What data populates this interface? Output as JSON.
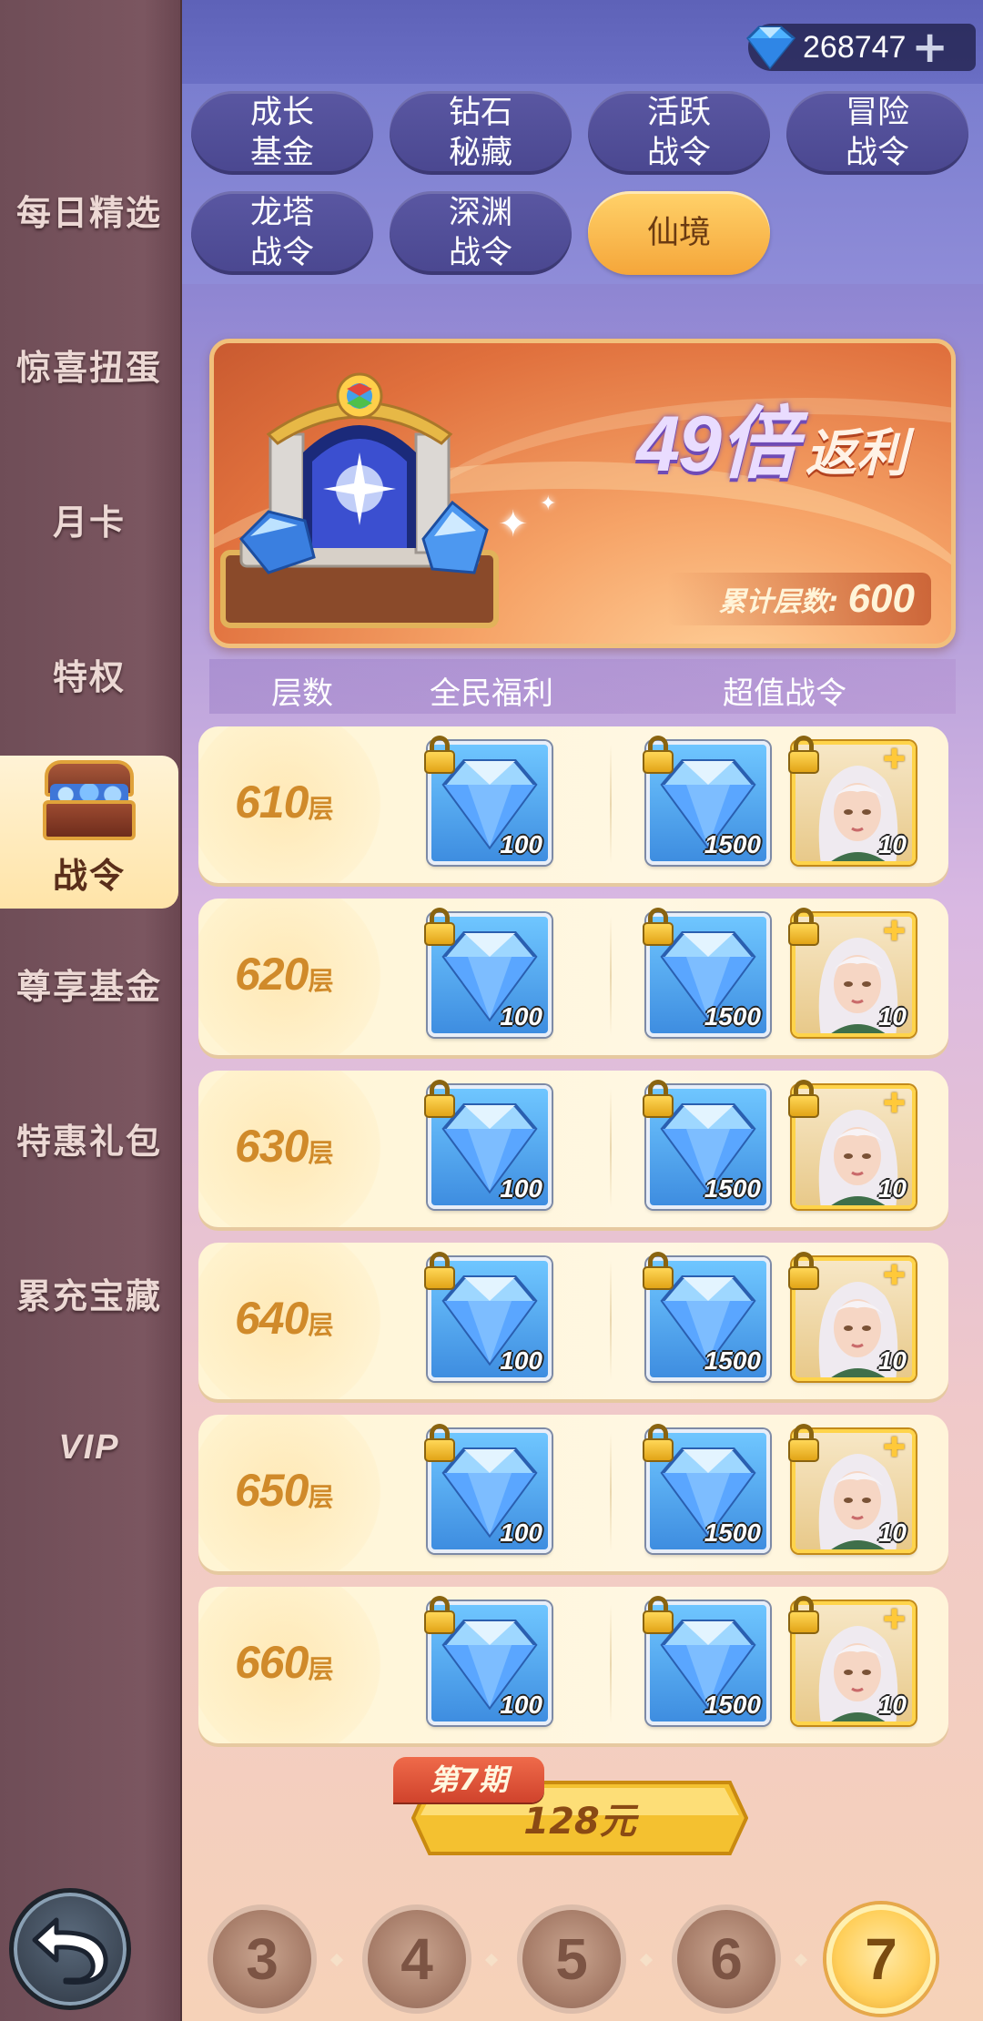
{
  "currency": {
    "amount": "268747",
    "icon": "diamond-icon",
    "add_icon": "plus-icon"
  },
  "sidebar": {
    "items": [
      {
        "label": "每日精选"
      },
      {
        "label": "惊喜扭蛋"
      },
      {
        "label": "月卡"
      },
      {
        "label": "特权"
      },
      {
        "label": "战令",
        "active": true
      },
      {
        "label": "尊享基金"
      },
      {
        "label": "特惠礼包"
      },
      {
        "label": "累充宝藏"
      },
      {
        "label": "VIP"
      }
    ],
    "back_icon": "back-arrow-icon"
  },
  "tabs": [
    {
      "label": "成长\n基金"
    },
    {
      "label": "钻石\n秘藏"
    },
    {
      "label": "活跃\n战令"
    },
    {
      "label": "冒险\n战令"
    },
    {
      "label": "龙塔\n战令"
    },
    {
      "label": "深渊\n战令"
    },
    {
      "label": "仙境",
      "active": true
    }
  ],
  "banner": {
    "multiplier": "49倍",
    "rebate": "返利",
    "count_label": "累计层数:",
    "count_value": "600"
  },
  "columns": {
    "floor": "层数",
    "free": "全民福利",
    "premium": "超值战令"
  },
  "rows": [
    {
      "floor": "610",
      "unit": "层",
      "free_qty": "100",
      "premium_qty": "1500",
      "hero_qty": "10"
    },
    {
      "floor": "620",
      "unit": "层",
      "free_qty": "100",
      "premium_qty": "1500",
      "hero_qty": "10"
    },
    {
      "floor": "630",
      "unit": "层",
      "free_qty": "100",
      "premium_qty": "1500",
      "hero_qty": "10"
    },
    {
      "floor": "640",
      "unit": "层",
      "free_qty": "100",
      "premium_qty": "1500",
      "hero_qty": "10"
    },
    {
      "floor": "650",
      "unit": "层",
      "free_qty": "100",
      "premium_qty": "1500",
      "hero_qty": "10"
    },
    {
      "floor": "660",
      "unit": "层",
      "free_qty": "100",
      "premium_qty": "1500",
      "hero_qty": "10"
    }
  ],
  "purchase": {
    "period": "第7期",
    "price": "128元"
  },
  "pager": {
    "pages": [
      "3",
      "4",
      "5",
      "6",
      "7"
    ],
    "active": "7"
  },
  "colors": {
    "accent": "#f5a63a",
    "sidebar": "#7b5660",
    "tab": "#4a4790"
  }
}
